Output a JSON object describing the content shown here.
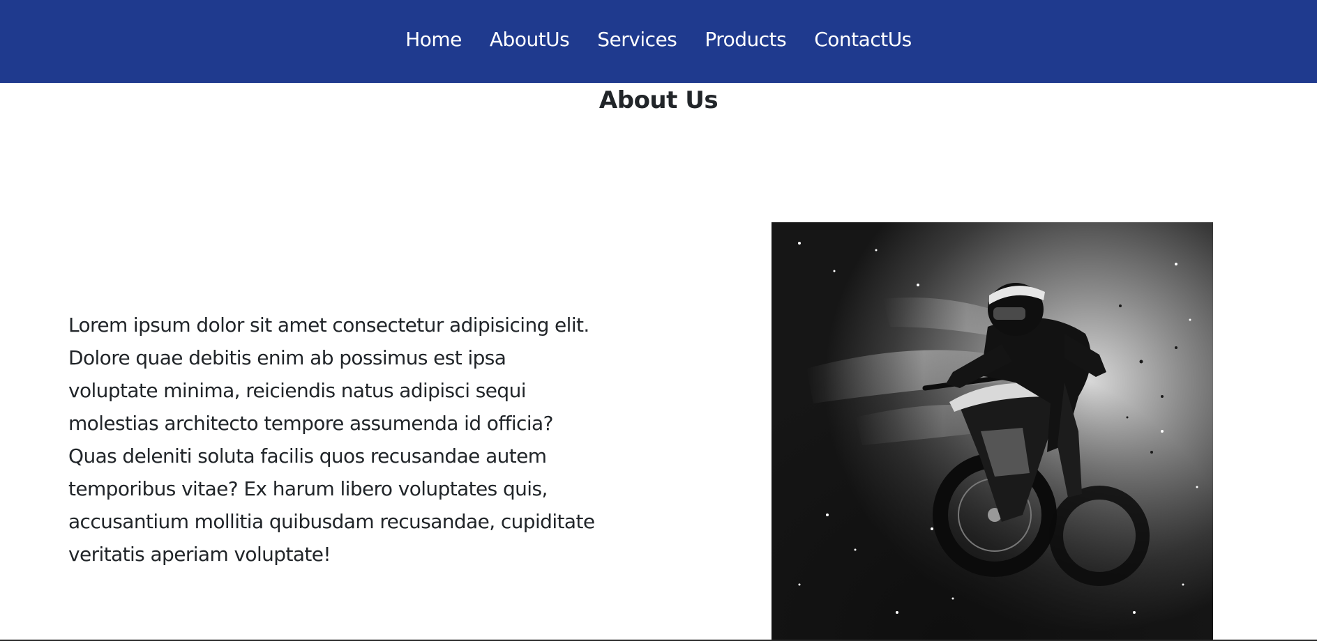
{
  "nav": {
    "items": [
      {
        "label": "Home"
      },
      {
        "label": "AboutUs"
      },
      {
        "label": "Services"
      },
      {
        "label": "Products"
      },
      {
        "label": "ContactUs"
      }
    ],
    "background_color": "#1f3a8e",
    "text_color": "#ffffff"
  },
  "about": {
    "title": "About Us",
    "body": "Lorem ipsum dolor sit amet consectetur adipisicing elit. Dolore quae debitis enim ab possimus est ipsa voluptate minima, reiciendis natus adipisci sequi molestias architecto tempore assumenda id officia? Quas deleniti soluta facilis quos recusandae autem temporibus vitae? Ex harum libero voluptates quis, accusantium mollitia quibusdam recusandae, cupiditate veritatis aperiam voluptate!",
    "image": {
      "subject": "motocross-rider-photo",
      "tone": "black-and-white"
    }
  }
}
